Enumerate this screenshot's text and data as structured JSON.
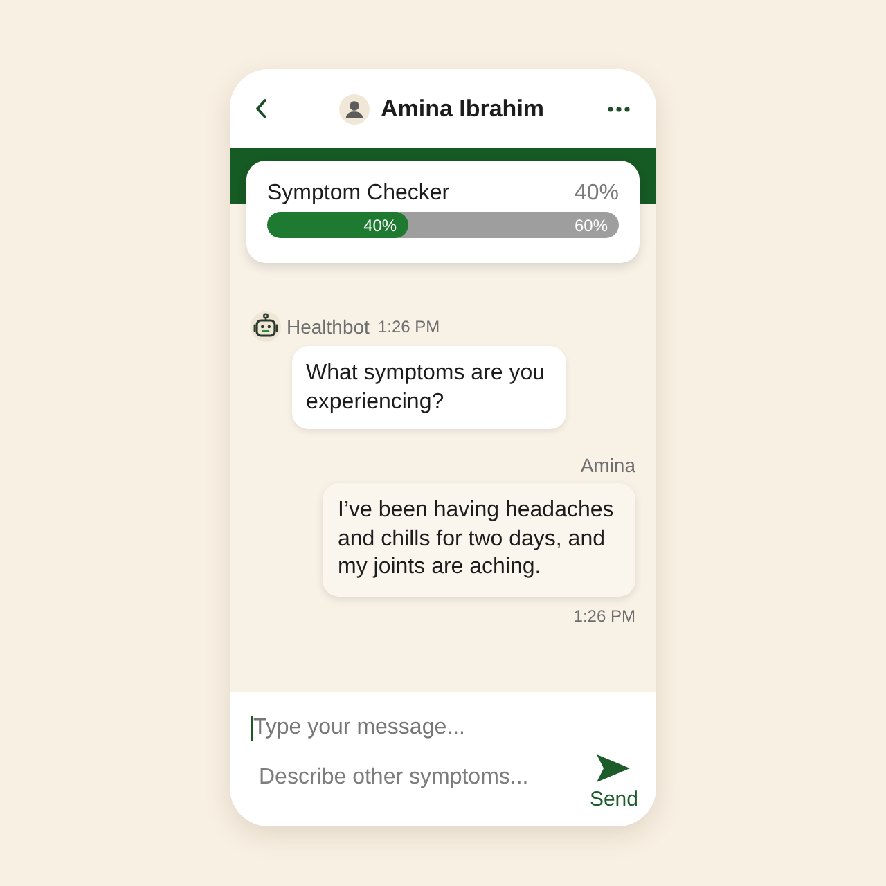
{
  "header": {
    "title": "Amina Ibrahim"
  },
  "progress": {
    "title": "Symptom Checker",
    "reading": "40%",
    "level": 0.4,
    "fill_label": "40%",
    "rest_label": "60%"
  },
  "messages": [
    {
      "kind": "bot",
      "sender": "Healthbot",
      "time": "1:26 PM",
      "text": "What symptoms are you experiencing?"
    },
    {
      "kind": "user",
      "sender": "Amina",
      "text": "I’ve been having headaches and chills for two days, and my joints are aching.",
      "time": "1:26 PM"
    }
  ],
  "composer": {
    "placeholder": "Type your message...",
    "hint": "Describe other symptoms...",
    "send_label": "Send"
  }
}
